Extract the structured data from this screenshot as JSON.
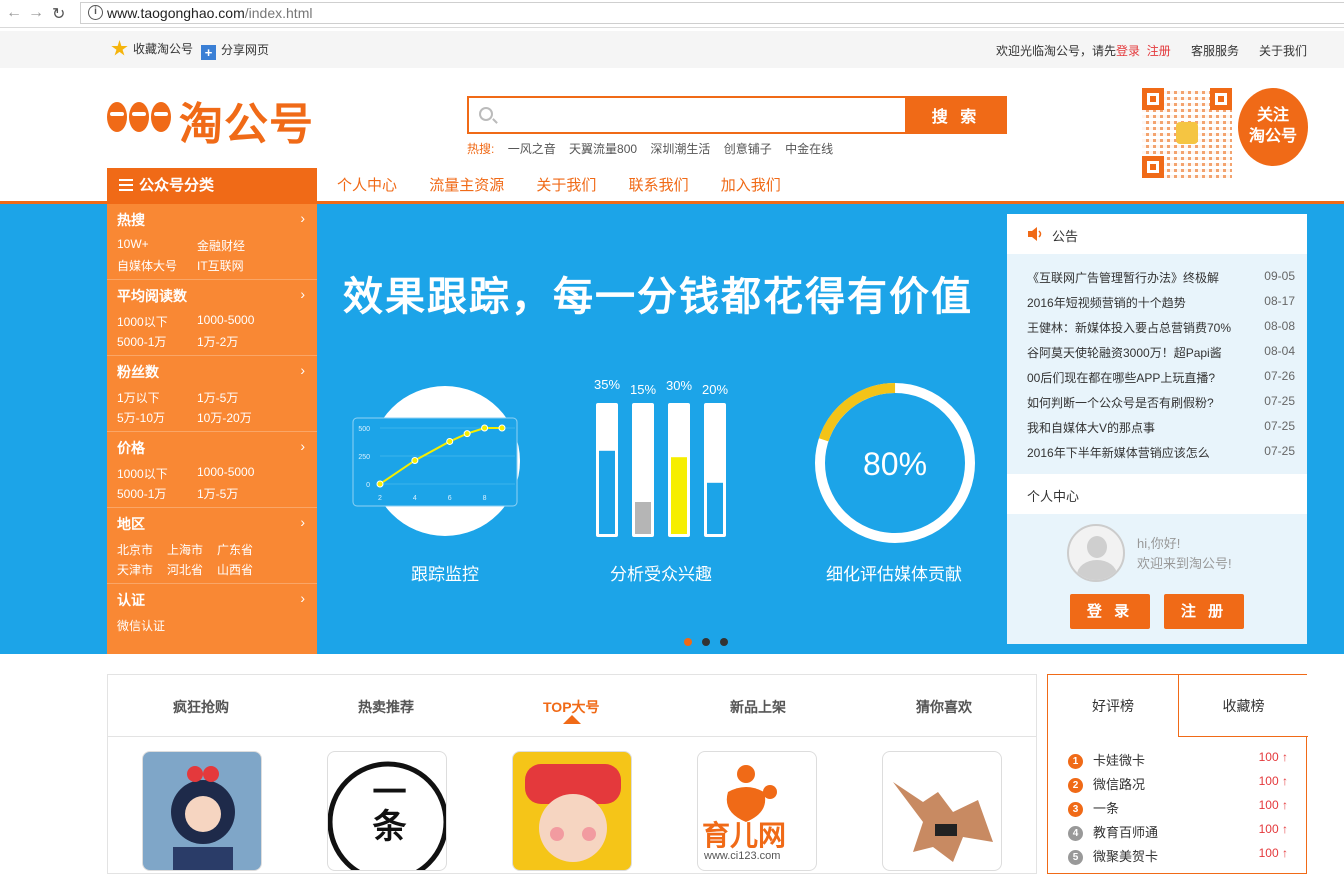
{
  "browser": {
    "url_host": "www.taogonghao.com",
    "url_path": "/index.html"
  },
  "topbar": {
    "favorite": "收藏淘公号",
    "share": "分享网页",
    "welcome": "欢迎光临淘公号，请先",
    "login": "登录",
    "register": "注册",
    "service": "客服服务",
    "about": "关于我们"
  },
  "logo": {
    "text": "淘公号"
  },
  "search": {
    "placeholder": "",
    "button": "搜 索",
    "hot_label": "热搜:",
    "hot_words": [
      "一风之音",
      "天翼流量800",
      "深圳潮生活",
      "创意铺子",
      "中金在线"
    ]
  },
  "follow": {
    "line1": "关注",
    "line2": "淘公号"
  },
  "nav": {
    "category_title": "公众号分类",
    "items": [
      "个人中心",
      "流量主资源",
      "关于我们",
      "联系我们",
      "加入我们"
    ]
  },
  "categories": [
    {
      "title": "热搜",
      "links": [
        "10W+",
        "金融财经",
        "自媒体大号",
        "IT互联网"
      ]
    },
    {
      "title": "平均阅读数",
      "links": [
        "1000以下",
        "1000-5000",
        "5000-1万",
        "1万-2万"
      ]
    },
    {
      "title": "粉丝数",
      "links": [
        "1万以下",
        "1万-5万",
        "5万-10万",
        "10万-20万"
      ]
    },
    {
      "title": "价格",
      "links": [
        "1000以下",
        "1000-5000",
        "5000-1万",
        "1万-5万"
      ]
    },
    {
      "title": "地区",
      "links": [
        "北京市",
        "上海市",
        "广东省",
        "天津市",
        "河北省",
        "山西省"
      ]
    },
    {
      "title": "认证",
      "links": [
        "微信认证"
      ]
    }
  ],
  "banner": {
    "slogan": "效果跟踪，每一分钱都花得有价值",
    "captions": [
      "跟踪监控",
      "分析受众兴趣",
      "细化评估媒体贡献"
    ],
    "donut_label": "80%"
  },
  "chart_data": [
    {
      "type": "line",
      "x": [
        2,
        3,
        4,
        5,
        6,
        7,
        8,
        9
      ],
      "values": [
        0,
        70,
        210,
        160,
        380,
        450,
        500,
        500
      ],
      "ticks_x": [
        "2",
        "4",
        "6",
        "8"
      ],
      "ticks_y": [
        "0",
        "250",
        "500"
      ],
      "ylim": [
        0,
        500
      ]
    },
    {
      "type": "bar",
      "categories": [
        "35%",
        "15%",
        "30%",
        "20%"
      ],
      "values": [
        65,
        25,
        60,
        40
      ],
      "colors": [
        "#1ca4e8",
        "#b5b5b5",
        "#f6ee00",
        "#1ca4e8"
      ],
      "ylim": [
        0,
        100
      ]
    },
    {
      "type": "pie",
      "values": [
        80,
        20
      ],
      "label": "80%",
      "colors": [
        "#ffffff",
        "#f3c318"
      ]
    }
  ],
  "notice": {
    "title": "公告",
    "items": [
      {
        "text": "《互联网广告管理暂行办法》终极解",
        "date": "09-05"
      },
      {
        "text": "2016年短视频营销的十个趋势",
        "date": "08-17"
      },
      {
        "text": "王健林：新媒体投入要占总营销费70%",
        "date": "08-08"
      },
      {
        "text": "谷阿莫天使轮融资3000万！超Papi酱",
        "date": "08-04"
      },
      {
        "text": "00后们现在都在哪些APP上玩直播?",
        "date": "07-26"
      },
      {
        "text": "如何判断一个公众号是否有刷假粉?",
        "date": "07-25"
      },
      {
        "text": "我和自媒体大V的那点事",
        "date": "07-25"
      },
      {
        "text": "2016年下半年新媒体营销应该怎么",
        "date": "07-25"
      }
    ]
  },
  "personal": {
    "title": "个人中心",
    "greeting": "hi,你好!",
    "welcome": "欢迎来到淘公号!",
    "login": "登 录",
    "register": "注 册"
  },
  "tabs": [
    "疯狂抢购",
    "热卖推荐",
    "TOP大号",
    "新品上架",
    "猜你喜欢"
  ],
  "cards": [
    {
      "name": "",
      "text": ""
    },
    {
      "name": "",
      "text": "一条"
    },
    {
      "name": "",
      "text": ""
    },
    {
      "name": "",
      "text": "育儿网",
      "sub": "www.ci123.com"
    },
    {
      "name": "",
      "text": ""
    }
  ],
  "rank": {
    "tab1": "好评榜",
    "tab2": "收藏榜",
    "items": [
      {
        "num": "1",
        "name": "卡娃微卡",
        "value": "100"
      },
      {
        "num": "2",
        "name": "微信路况",
        "value": "100"
      },
      {
        "num": "3",
        "name": "一条",
        "value": "100"
      },
      {
        "num": "4",
        "name": "教育百师通",
        "value": "100"
      },
      {
        "num": "5",
        "name": "微聚美贺卡",
        "value": "100"
      }
    ]
  },
  "colors": {
    "brand": "#f06a17",
    "banner": "#1ca4e8",
    "sidebar": "#f98834"
  }
}
